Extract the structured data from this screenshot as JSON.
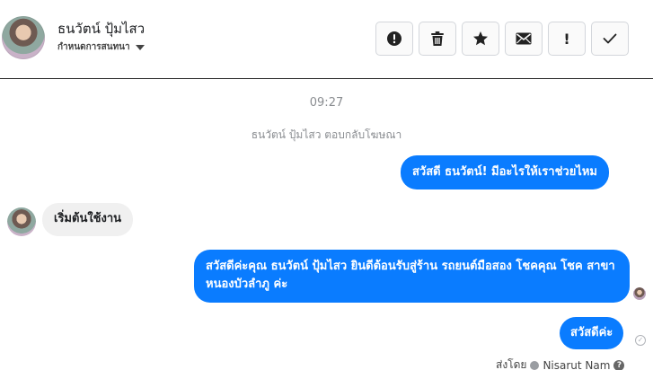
{
  "header": {
    "contact_name": "ธนวัตน์ ปุ้มไสว",
    "label_text": "กำหนดการสนทนา",
    "actions": [
      {
        "name": "spam",
        "icon": "alert-circle-icon"
      },
      {
        "name": "delete",
        "icon": "trash-icon"
      },
      {
        "name": "star",
        "icon": "star-icon"
      },
      {
        "name": "mark-unread",
        "icon": "envelope-icon"
      },
      {
        "name": "follow-up",
        "icon": "exclamation-icon",
        "glyph": "!"
      },
      {
        "name": "mark-done",
        "icon": "checkmark-icon"
      }
    ]
  },
  "conversation": {
    "time": "09:27",
    "system_line": "ธนวัตน์ ปุ้มไสว ตอบกลับโฆษณา",
    "messages": [
      {
        "direction": "outgoing",
        "text": "สวัสดี ธนวัตน์! มีอะไรให้เราช่วยไหม"
      },
      {
        "direction": "incoming",
        "text": "เริ่มต้นใช้งาน"
      },
      {
        "direction": "outgoing",
        "text": "สวัสดีค่ะคุณ ธนวัตน์ ปุ้มไสว ยินดีต้อนรับสู่ร้าน รถยนต์มือสอง โชคคุณ โชค สาขาหนองบัวลำภู ค่ะ"
      },
      {
        "direction": "outgoing",
        "text": "สวัสดีค่ะ"
      }
    ],
    "sent_by_label": "ส่งโดย",
    "sent_by_name": "Nisarut Nam",
    "help_glyph": "?",
    "sent_check_glyph": "✓"
  },
  "colors": {
    "outgoing_bubble": "#0a7cff",
    "incoming_bubble": "#f0f0f0",
    "muted_text": "#8a8d91"
  }
}
